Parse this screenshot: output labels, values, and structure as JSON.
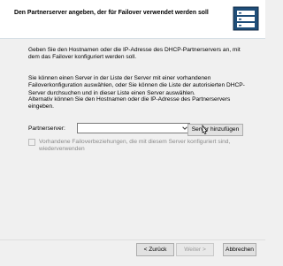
{
  "header": {
    "title": "Den Partnerserver angeben, der für Failover verwendet werden soll"
  },
  "content": {
    "intro": "Geben Sie den Hostnamen oder die IP-Adresse des DHCP-Partnerservers an, mit dem das Failover konfiguriert werden soll.",
    "paragraph2": "Sie können einen Server in der Liste der Server mit einer vorhandenen Failoverkonfiguration auswählen, oder Sie können die Liste der autorisierten DHCP-Server durchsuchen und in dieser Liste einen Server auswählen.",
    "paragraph3": "Alternativ können Sie den Hostnamen oder die IP-Adresse des Partnerservers eingeben.",
    "partner_label": "Partnerserver:",
    "partner_value": "",
    "add_server_label": "Server hinzufügen",
    "reuse_checkbox_label": "Vorhandene Failoverbeziehungen, die mit diesem Server konfiguriert sind, wiederverwenden",
    "reuse_checked": false
  },
  "footer": {
    "back_label": "< Zurück",
    "next_label": "Weiter >",
    "cancel_label": "Abbrechen"
  },
  "icons": {
    "wizard": "wizard-server-icon",
    "dropdown": "chevron-down-icon",
    "cursor": "mouse-pointer-icon"
  }
}
